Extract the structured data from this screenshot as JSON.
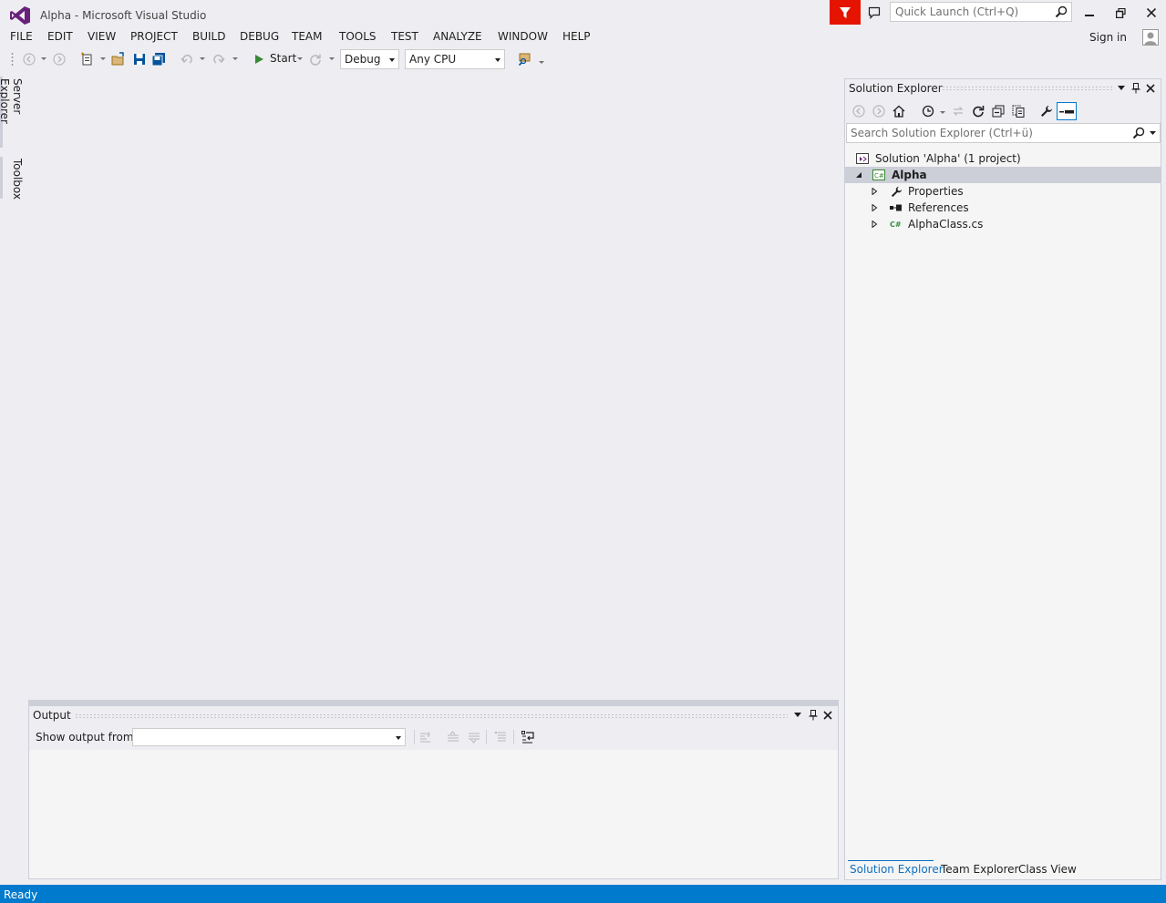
{
  "window": {
    "title": "Alpha - Microsoft Visual Studio",
    "quick_launch_placeholder": "Quick Launch (Ctrl+Q)",
    "sign_in": "Sign in",
    "colors": {
      "accent": "#007acc",
      "brand": "#68217a",
      "feedback": "#e51400"
    }
  },
  "menu": [
    "FILE",
    "EDIT",
    "VIEW",
    "PROJECT",
    "BUILD",
    "DEBUG",
    "TEAM",
    "TOOLS",
    "TEST",
    "ANALYZE",
    "WINDOW",
    "HELP"
  ],
  "toolbar": {
    "start_label": "Start",
    "configuration": "Debug",
    "platform": "Any CPU"
  },
  "side_tabs": [
    "Server Explorer",
    "Toolbox"
  ],
  "solution_explorer": {
    "title": "Solution Explorer",
    "search_placeholder": "Search Solution Explorer (Ctrl+ü)",
    "tree": {
      "solution": "Solution 'Alpha' (1 project)",
      "project": "Alpha",
      "items": [
        "Properties",
        "References",
        "AlphaClass.cs"
      ]
    }
  },
  "bottom_tabs": [
    "Solution Explorer",
    "Team Explorer",
    "Class View"
  ],
  "output": {
    "title": "Output",
    "show_from_label": "Show output from:",
    "show_from_value": ""
  },
  "status": {
    "text": "Ready"
  }
}
